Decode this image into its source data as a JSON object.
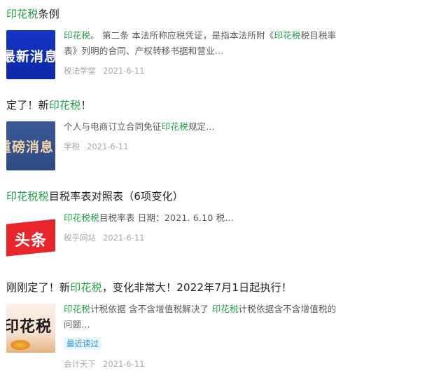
{
  "items": [
    {
      "title": [
        {
          "text": "印花税",
          "hl": true
        },
        {
          "text": "条例",
          "hl": false
        }
      ],
      "thumbnail_text": "最新消息",
      "snippet": [
        {
          "text": "印花税",
          "hl": true
        },
        {
          "text": "。 第二条 本法所称应税凭证，是指本法所附《",
          "hl": false
        },
        {
          "text": "印花税",
          "hl": true
        },
        {
          "text": "税目税率表》列明的合同、产权转移书据和营业...",
          "hl": false
        }
      ],
      "source": "税法学堂",
      "date": "2021-6-11"
    },
    {
      "title": [
        {
          "text": "定了！新",
          "hl": false
        },
        {
          "text": "印花税",
          "hl": true
        },
        {
          "text": "！",
          "hl": false
        }
      ],
      "thumbnail_text": "重磅消息",
      "snippet": [
        {
          "text": "个人与电商订立合同免征",
          "hl": false
        },
        {
          "text": "印花税",
          "hl": true
        },
        {
          "text": "规定...",
          "hl": false
        }
      ],
      "source": "学税",
      "date": "2021-6-11"
    },
    {
      "title": [
        {
          "text": "印花税税",
          "hl": true
        },
        {
          "text": "目税率表对照表（6项变化）",
          "hl": false
        }
      ],
      "thumbnail_text": "头条",
      "snippet": [
        {
          "text": "印花税税",
          "hl": true
        },
        {
          "text": "目税率表 日期：2021. 6.10 税...",
          "hl": false
        }
      ],
      "source": "税乎网站",
      "date": "2021-6-11"
    },
    {
      "title": [
        {
          "text": "刚刚定了！新",
          "hl": false
        },
        {
          "text": "印花税",
          "hl": true
        },
        {
          "text": "，变化非常大！2022年7月1日起执行！",
          "hl": false
        }
      ],
      "thumbnail_text": "印花税",
      "snippet": [
        {
          "text": "印花税",
          "hl": true
        },
        {
          "text": "计税依据 含不含增值税解决了 ",
          "hl": false
        },
        {
          "text": "印花税",
          "hl": true
        },
        {
          "text": "计税依据含不含增值税的问题...",
          "hl": false
        }
      ],
      "badge": "最近读过",
      "source": "会计天下",
      "date": "2021-6-11"
    }
  ],
  "colors": {
    "highlight": "#21a04a",
    "title": "#222222",
    "snippet": "#595959",
    "meta": "#a8a8a8",
    "badge_text": "#2f8fd6",
    "badge_bg": "#e6f6fc"
  }
}
